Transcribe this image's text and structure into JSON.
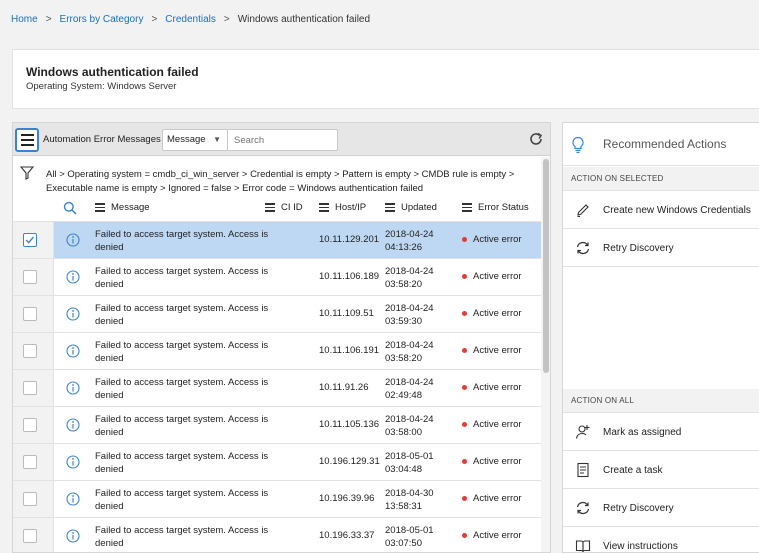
{
  "breadcrumb": {
    "items": [
      {
        "label": "Home"
      },
      {
        "label": "Errors by Category"
      },
      {
        "label": "Credentials"
      }
    ],
    "separator": ">",
    "current": "Windows authentication failed"
  },
  "header": {
    "title": "Windows authentication failed",
    "subtitle": "Operating System: Windows Server"
  },
  "list": {
    "toolbar": {
      "title": "Automation Error Messages",
      "field_select": "Message",
      "search_placeholder": "Search"
    },
    "filter": {
      "text": "All  >  Operating system = cmdb_ci_win_server  >  Credential is empty  >  Pattern is empty  >  CMDB rule is empty  >  Executable name is empty  >  Ignored = false  >  Error code = Windows authentication failed"
    },
    "columns": {
      "message": "Message",
      "ci_id": "CI ID",
      "host_ip": "Host/IP",
      "updated": "Updated",
      "error_status": "Error Status"
    },
    "rows": [
      {
        "msg1": "Failed to access target system. Access is",
        "msg2": "denied",
        "host": "10.11.129.201",
        "date": "2018-04-24",
        "time": "04:13:26",
        "status": "Active error",
        "selected": true
      },
      {
        "msg1": "Failed to access target system. Access is",
        "msg2": "denied",
        "host": "10.11.106.189",
        "date": "2018-04-24",
        "time": "03:58:20",
        "status": "Active error",
        "selected": false
      },
      {
        "msg1": "Failed to access target system. Access is",
        "msg2": "denied",
        "host": "10.11.109.51",
        "date": "2018-04-24",
        "time": "03:59:30",
        "status": "Active error",
        "selected": false
      },
      {
        "msg1": "Failed to access target system. Access is",
        "msg2": "denied",
        "host": "10.11.106.191",
        "date": "2018-04-24",
        "time": "03:58:20",
        "status": "Active error",
        "selected": false
      },
      {
        "msg1": "Failed to access target system. Access is",
        "msg2": "denied",
        "host": "10.11.91.26",
        "date": "2018-04-24",
        "time": "02:49:48",
        "status": "Active error",
        "selected": false
      },
      {
        "msg1": "Failed to access target system. Access is",
        "msg2": "denied",
        "host": "10.11.105.136",
        "date": "2018-04-24",
        "time": "03:58:00",
        "status": "Active error",
        "selected": false
      },
      {
        "msg1": "Failed to access target system. Access is",
        "msg2": "denied",
        "host": "10.196.129.31",
        "date": "2018-05-01",
        "time": "03:04:48",
        "status": "Active error",
        "selected": false
      },
      {
        "msg1": "Failed to access target system. Access is",
        "msg2": "denied",
        "host": "10.196.39.96",
        "date": "2018-04-30",
        "time": "13:58:31",
        "status": "Active error",
        "selected": false
      },
      {
        "msg1": "Failed to access target system. Access is",
        "msg2": "denied",
        "host": "10.196.33.37",
        "date": "2018-05-01",
        "time": "03:07:50",
        "status": "Active error",
        "selected": false
      }
    ]
  },
  "recommended": {
    "title": "Recommended Actions",
    "section_selected": "ACTION ON SELECTED",
    "actions_selected": [
      {
        "label": "Create new Windows Credentials",
        "icon": "pencil-icon"
      },
      {
        "label": "Retry Discovery",
        "icon": "refresh-icon"
      }
    ],
    "section_all": "ACTION ON ALL",
    "actions_all": [
      {
        "label": "Mark as assigned",
        "icon": "assign-user-icon"
      },
      {
        "label": "Create a task",
        "icon": "task-icon"
      },
      {
        "label": "Retry Discovery",
        "icon": "refresh-icon"
      },
      {
        "label": "View instructions",
        "icon": "book-icon"
      }
    ]
  },
  "colors": {
    "link": "#1f6fb5",
    "selected_row": "#bed7f3",
    "error_dot": "#e03c3c",
    "accent": "#3a84d0"
  }
}
